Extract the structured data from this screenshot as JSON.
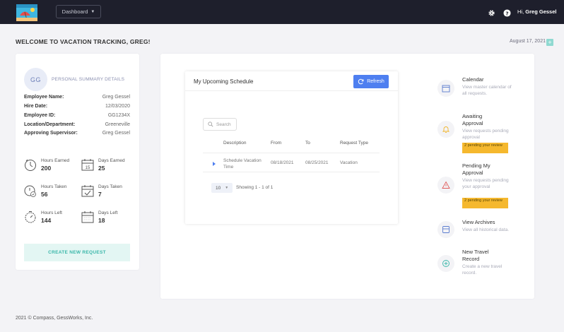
{
  "topbar": {
    "dashboard_label": "Dashboard",
    "greeting_prefix": "Hi,",
    "user_name": "Greg Gessel"
  },
  "header": {
    "welcome": "WELCOME TO VACATION TRACKING, GREG!",
    "date": "August 17, 2021",
    "add_symbol": "+"
  },
  "summary": {
    "initials": "GG",
    "title": "PERSONAL SUMMARY DETAILS",
    "details": [
      {
        "label": "Employee Name:",
        "value": "Greg Gessel"
      },
      {
        "label": "Hire Date:",
        "value": "12/03/2020"
      },
      {
        "label": "Employee ID:",
        "value": "GG1234X"
      },
      {
        "label": "Location/Department:",
        "value": "Greeneville"
      },
      {
        "label": "Approving Supervisor:",
        "value": "Greg Gessel"
      }
    ],
    "stats": [
      {
        "label": "Hours Earned",
        "value": "200"
      },
      {
        "label": "Days Earned",
        "value": "25"
      },
      {
        "label": "Hours Taken",
        "value": "56"
      },
      {
        "label": "Days Taken",
        "value": "7"
      },
      {
        "label": "Hours Left",
        "value": "144"
      },
      {
        "label": "Days Left",
        "value": "18"
      }
    ],
    "calendar_day": "15",
    "create_button": "CREATE NEW REQUEST"
  },
  "schedule": {
    "title": "My Upcoming Schedule",
    "refresh_label": "Refresh",
    "search_placeholder": "Search",
    "columns": [
      "Description",
      "From",
      "To",
      "Request Type"
    ],
    "rows": [
      {
        "description": "Schedule Vacation Time",
        "from": "08/18/2021",
        "to": "08/25/2021",
        "type": "Vacation"
      }
    ],
    "page_size": "10",
    "showing": "Showing 1 - 1 of 1"
  },
  "side_menu": [
    {
      "title": "Calendar",
      "desc": "View master calendar of all requests."
    },
    {
      "title": "Awaiting Approval",
      "desc": "View requests pending approval",
      "badge": "2 pending your review"
    },
    {
      "title": "Pending My Approval",
      "desc": "View requests pending your approval",
      "badge": "2 pending your review"
    },
    {
      "title": "View Archives",
      "desc": "View all historical data."
    },
    {
      "title": "New Travel Record",
      "desc": "Create a new travel record."
    }
  ],
  "footer": {
    "text": "2021 © Compass, GessWorks, Inc."
  },
  "colors": {
    "topbar": "#1e1f2c",
    "accent_blue": "#4e7ff0",
    "teal": "#3bb7aa",
    "badge_yellow": "#f5b82e"
  }
}
